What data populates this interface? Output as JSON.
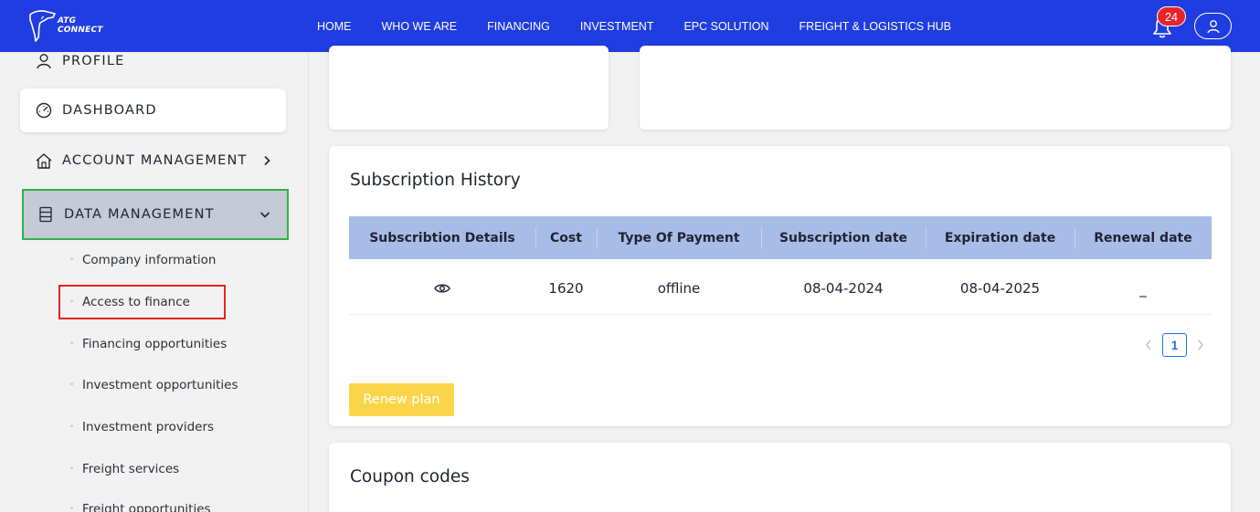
{
  "brand": {
    "line1": "ATG",
    "line2": "CONNECT"
  },
  "nav": {
    "items": [
      "HOME",
      "WHO WE ARE",
      "FINANCING",
      "INVESTMENT",
      "EPC SOLUTION",
      "FREIGHT & LOGISTICS HUB"
    ]
  },
  "notifications": {
    "count": "24"
  },
  "sidebar": {
    "profile": "PROFILE",
    "dashboard": "DASHBOARD",
    "account_management": "ACCOUNT MANAGEMENT",
    "data_management": "DATA MANAGEMENT",
    "sub_items": [
      "Company information",
      "Access to finance",
      "Financing opportunities",
      "Investment opportunities",
      "Investment providers",
      "Freight services",
      "Freight opportunities"
    ]
  },
  "subscription": {
    "title": "Subscription History",
    "columns": [
      "Subscribtion Details",
      "Cost",
      "Type Of Payment",
      "Subscription date",
      "Expiration date",
      "Renewal date"
    ],
    "rows": [
      {
        "cost": "1620",
        "payment_type": "offline",
        "subscription_date": "08-04-2024",
        "expiration_date": "08-04-2025",
        "renewal_date": "_"
      }
    ],
    "current_page": "1",
    "renew_label": "Renew plan"
  },
  "coupons": {
    "title": "Coupon codes"
  },
  "colors": {
    "nav_bg": "#1f3de0",
    "table_head": "#a8bce8",
    "renew_button": "#fad54a",
    "badge": "#e8232b"
  }
}
